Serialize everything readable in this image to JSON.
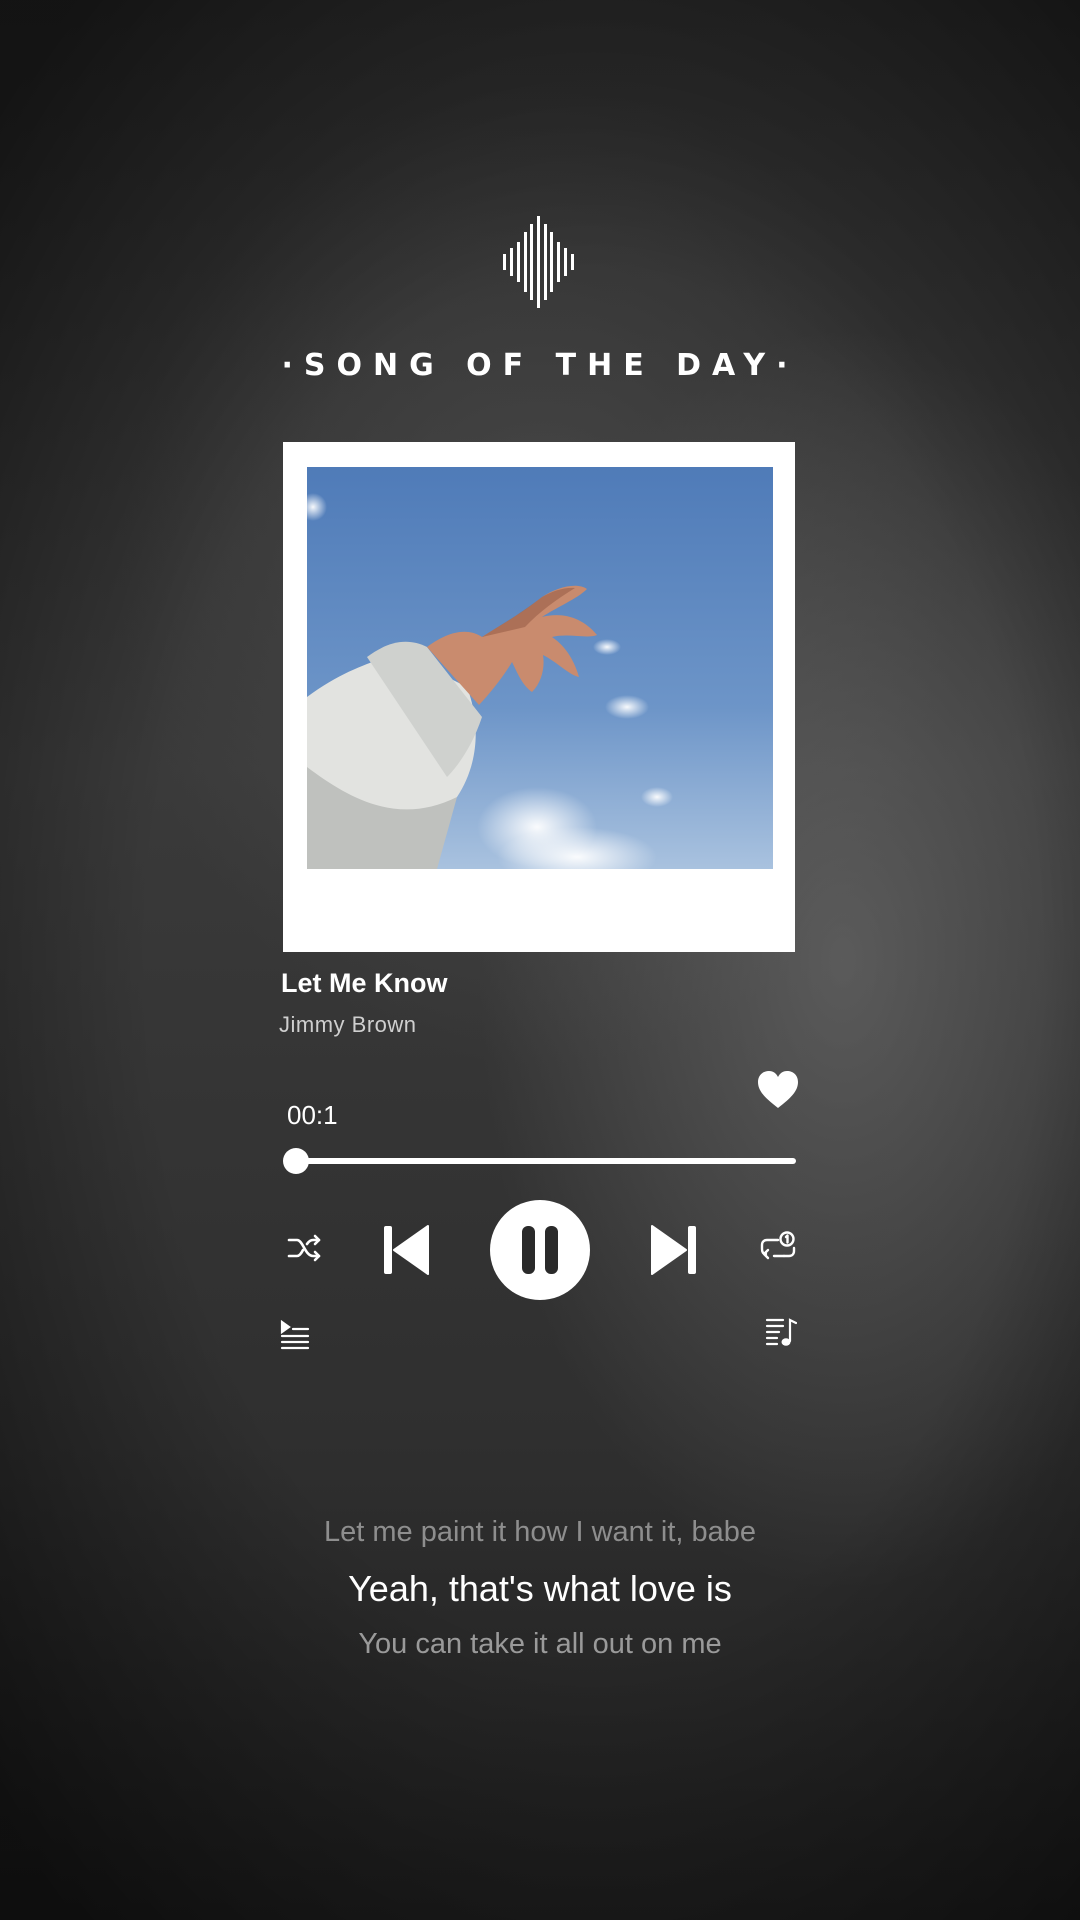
{
  "header": {
    "title": "·SONG OF THE DAY·",
    "logo_icon": "sound-wave-icon"
  },
  "track": {
    "title": "Let Me Know",
    "artist": "Jimmy Brown",
    "liked": true
  },
  "playback": {
    "elapsed": "00:1",
    "progress_fraction": 0.0,
    "state": "playing"
  },
  "controls": {
    "shuffle_icon": "shuffle-icon",
    "previous_icon": "skip-previous-icon",
    "play_pause_icon": "pause-icon",
    "next_icon": "skip-next-icon",
    "repeat_icon": "repeat-one-icon",
    "queue_icon": "queue-list-icon",
    "playlist_icon": "playlist-music-icon",
    "like_icon": "heart-icon"
  },
  "lyrics": {
    "previous": "Let me paint it how I want it, babe",
    "current": "Yeah, that's what love is",
    "next": "You can take it all out on me"
  },
  "colors": {
    "accent": "#ffffff",
    "muted_text": "#8e8e8e",
    "background": "#2f2f2f"
  }
}
